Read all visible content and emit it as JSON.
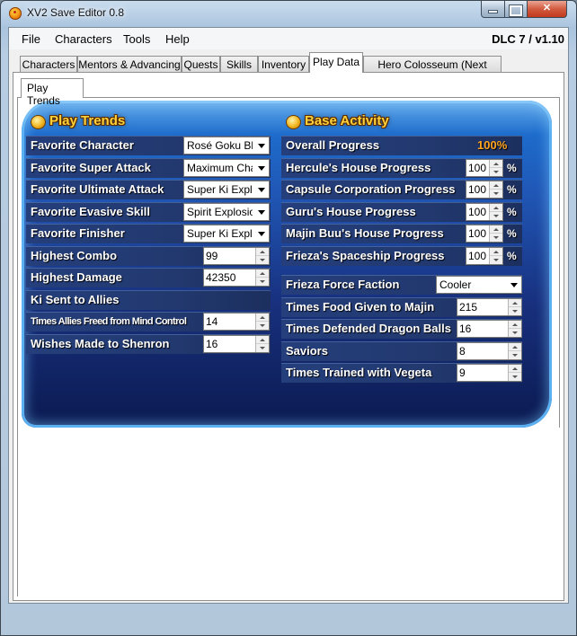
{
  "window": {
    "title": "XV2 Save Editor 0.8"
  },
  "menu": {
    "items": [
      "File",
      "Characters",
      "Tools",
      "Help"
    ],
    "version": "DLC 7 / v1.10"
  },
  "tabs": [
    "Characters",
    "Mentors & Advancing",
    "Quests",
    "Skills",
    "Inventory",
    "Play Data",
    "Hero Colosseum (Next update)"
  ],
  "active_tab": "Play Data",
  "subtab": "Play Trends",
  "play_trends": {
    "title": "Play Trends",
    "favorite_character": {
      "label": "Favorite Character",
      "value": "Rosé Goku Bla"
    },
    "favorite_super_attack": {
      "label": "Favorite Super Attack",
      "value": "Maximum Charg"
    },
    "favorite_ultimate_attack": {
      "label": "Favorite Ultimate Attack",
      "value": "Super Ki Explos"
    },
    "favorite_evasive_skill": {
      "label": "Favorite Evasive Skill",
      "value": "Spirit Explosion"
    },
    "favorite_finisher": {
      "label": "Favorite Finisher",
      "value": "Super Ki Explos"
    },
    "highest_combo": {
      "label": "Highest Combo",
      "value": "99"
    },
    "highest_damage": {
      "label": "Highest Damage",
      "value": "42350"
    },
    "ki_sent": {
      "label": "Ki Sent to Allies"
    },
    "times_allies_freed": {
      "label": "Times Allies Freed from Mind Control",
      "value": "14"
    },
    "wishes_made": {
      "label": "Wishes Made to Shenron",
      "value": "16"
    }
  },
  "base_activity": {
    "title": "Base Activity",
    "overall_progress": {
      "label": "Overall Progress",
      "value": "100%"
    },
    "hercule": {
      "label": "Hercule's House Progress",
      "value": "100",
      "unit": "%"
    },
    "capsule": {
      "label": "Capsule Corporation Progress",
      "value": "100",
      "unit": "%"
    },
    "guru": {
      "label": "Guru's House Progress",
      "value": "100",
      "unit": "%"
    },
    "majin_buu": {
      "label": "Majin Buu's House Progress",
      "value": "100",
      "unit": "%"
    },
    "frieza_ship": {
      "label": "Frieza's Spaceship Progress",
      "value": "100",
      "unit": "%"
    },
    "frieza_force": {
      "label": "Frieza Force Faction",
      "value": "Cooler"
    },
    "food_given": {
      "label": "Times Food Given to Majin",
      "value": "215"
    },
    "dragon_balls": {
      "label": "Times Defended Dragon Balls",
      "value": "16"
    },
    "saviors": {
      "label": "Saviors",
      "value": "8"
    },
    "trained_vegeta": {
      "label": "Times Trained with Vegeta",
      "value": "9"
    }
  },
  "colors": {
    "accent_gold": "#ffd23a",
    "overall_orange": "#ffa520",
    "panel_blue": "#2057b6"
  }
}
